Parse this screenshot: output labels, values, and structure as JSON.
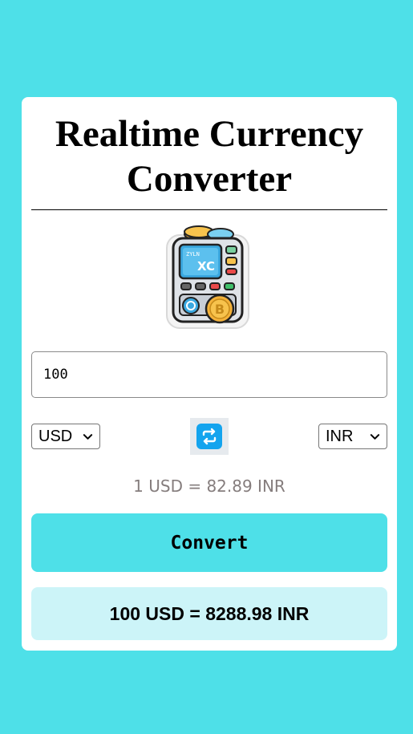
{
  "header": {
    "title": "Realtime Currency Converter"
  },
  "hero": {
    "icon": "currency-exchange-machine-icon",
    "screen_text_top": "ZYLN",
    "screen_text_mid": "XC"
  },
  "form": {
    "amount_value": "100",
    "from_currency": "USD",
    "to_currency": "INR",
    "swap_icon": "swap-arrows-icon",
    "rate_text": "1 USD = 82.89 INR",
    "convert_label": "Convert"
  },
  "result": {
    "text": "100 USD = 8288.98 INR"
  },
  "colors": {
    "background": "#4ee0e8",
    "card": "#ffffff",
    "convert_button": "#4ee0e8",
    "result_box": "#ccf4f8",
    "rate_text": "#857d7d",
    "swap_icon": "#14a4ee"
  }
}
